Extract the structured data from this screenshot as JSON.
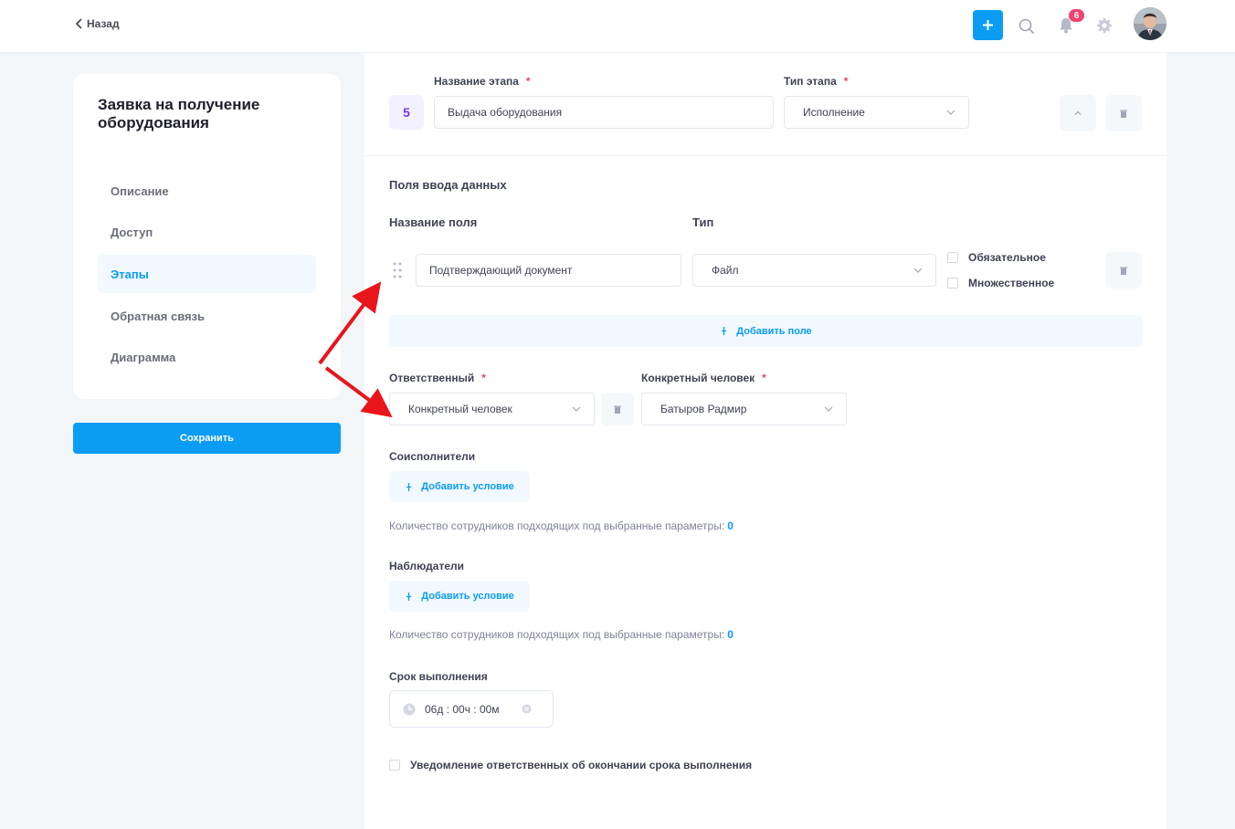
{
  "header": {
    "back_label": "Назад",
    "notifications_count": "6",
    "accent_color": "#0b9cf4"
  },
  "sidebar": {
    "title": "Заявка на получение оборудования",
    "items": [
      {
        "label": "Описание",
        "active": false
      },
      {
        "label": "Доступ",
        "active": false
      },
      {
        "label": "Этапы",
        "active": true
      },
      {
        "label": "Обратная связь",
        "active": false
      },
      {
        "label": "Диаграмма",
        "active": false
      }
    ],
    "save_label": "Сохранить"
  },
  "stage": {
    "number": "5",
    "name_label": "Название этапа",
    "name_value": "Выдача оборудования",
    "type_label": "Тип этапа",
    "type_value": "Исполнение",
    "required_mark": "*"
  },
  "input_fields": {
    "title": "Поля ввода данных",
    "col_name": "Название поля",
    "col_type": "Тип",
    "rows": [
      {
        "name": "Подтверждающий документ",
        "type": "Файл",
        "required_label": "Обязательное",
        "multiple_label": "Множественное"
      }
    ],
    "add_label": "Добавить поле"
  },
  "responsible": {
    "label": "Ответственный",
    "value": "Конкретный человек",
    "person_label": "Конкретный человек",
    "person_value": "Батыров Радмир"
  },
  "coexecutors": {
    "label": "Соисполнители",
    "add_label": "Добавить условие",
    "count_text": "Количество сотрудников подходящих под выбранные параметры:",
    "count": "0"
  },
  "observers": {
    "label": "Наблюдатели",
    "add_label": "Добавить условие",
    "count_text": "Количество сотрудников подходящих под выбранные параметры:",
    "count": "0"
  },
  "deadline": {
    "label": "Срок выполнения",
    "value": "06д : 00ч : 00м"
  },
  "notify": {
    "label": "Уведомление ответственных об окончании срока выполнения"
  },
  "annotation_color": "#e8151b"
}
